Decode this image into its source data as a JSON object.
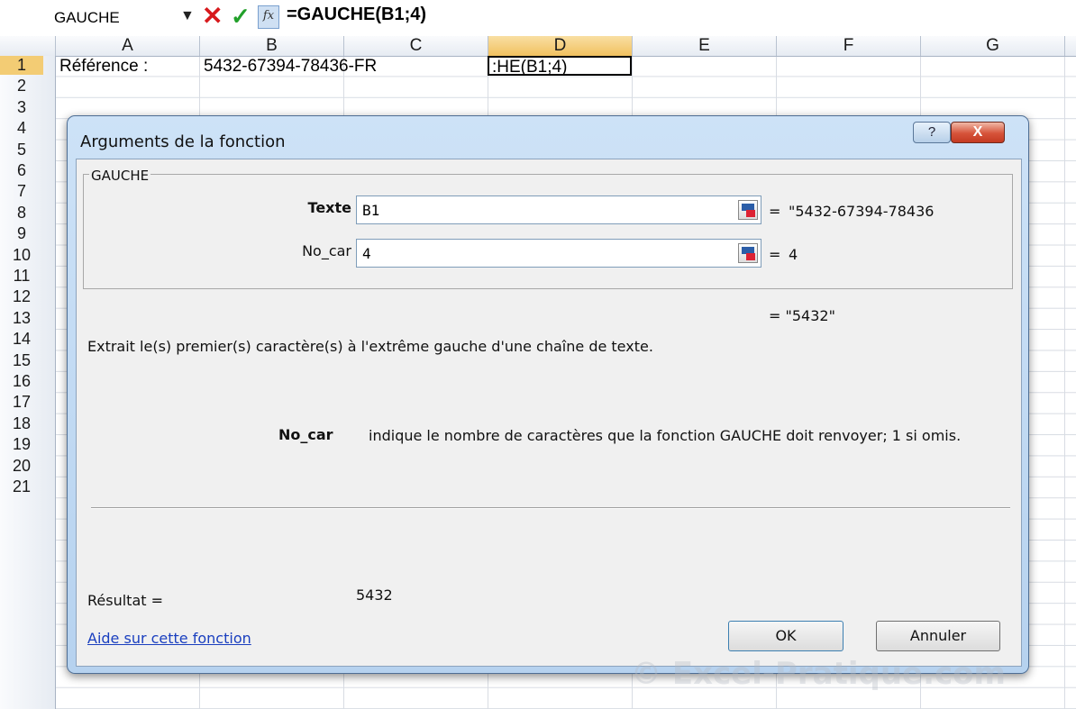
{
  "formula_bar": {
    "name_box": "GAUCHE",
    "formula": "=GAUCHE(B1;4)"
  },
  "grid": {
    "columns": [
      "A",
      "B",
      "C",
      "D",
      "E",
      "F",
      "G"
    ],
    "rows": [
      "1",
      "2",
      "3",
      "4",
      "5",
      "6",
      "7",
      "8",
      "9",
      "10",
      "11",
      "12",
      "13",
      "14",
      "15",
      "16",
      "17",
      "18",
      "19",
      "20",
      "21"
    ],
    "cells": {
      "a1": "Référence :",
      "b1": "5432-67394-78436-FR",
      "d1": ":HE(B1;4)"
    }
  },
  "dialog": {
    "title": "Arguments de la fonction",
    "help_btn": "?",
    "close_btn": "X",
    "group_label": "GAUCHE",
    "args": [
      {
        "label": "Texte",
        "value": "B1",
        "eq": "=",
        "result": "\"5432-67394-78436"
      },
      {
        "label": "No_car",
        "value": "4",
        "eq": "=",
        "result": "4"
      }
    ],
    "formula_result": "= \"5432\"",
    "description": "Extrait le(s) premier(s) caractère(s) à l'extrême gauche d'une chaîne de texte.",
    "param_name": "No_car",
    "param_description": "indique le nombre de caractères que la fonction GAUCHE doit renvoyer; 1 si omis.",
    "result_label": "Résultat =",
    "result_value": "5432",
    "help_link": "Aide sur cette fonction",
    "ok_button": "OK",
    "cancel_button": "Annuler"
  },
  "watermark": "© Excel-Pratique.com",
  "colors": {
    "dialog_frame": "#b6d2ef",
    "active_header": "#f1c15f",
    "link": "#1a3fbf",
    "cancel_icon": "#d7191c",
    "enter_icon": "#22a02a"
  }
}
